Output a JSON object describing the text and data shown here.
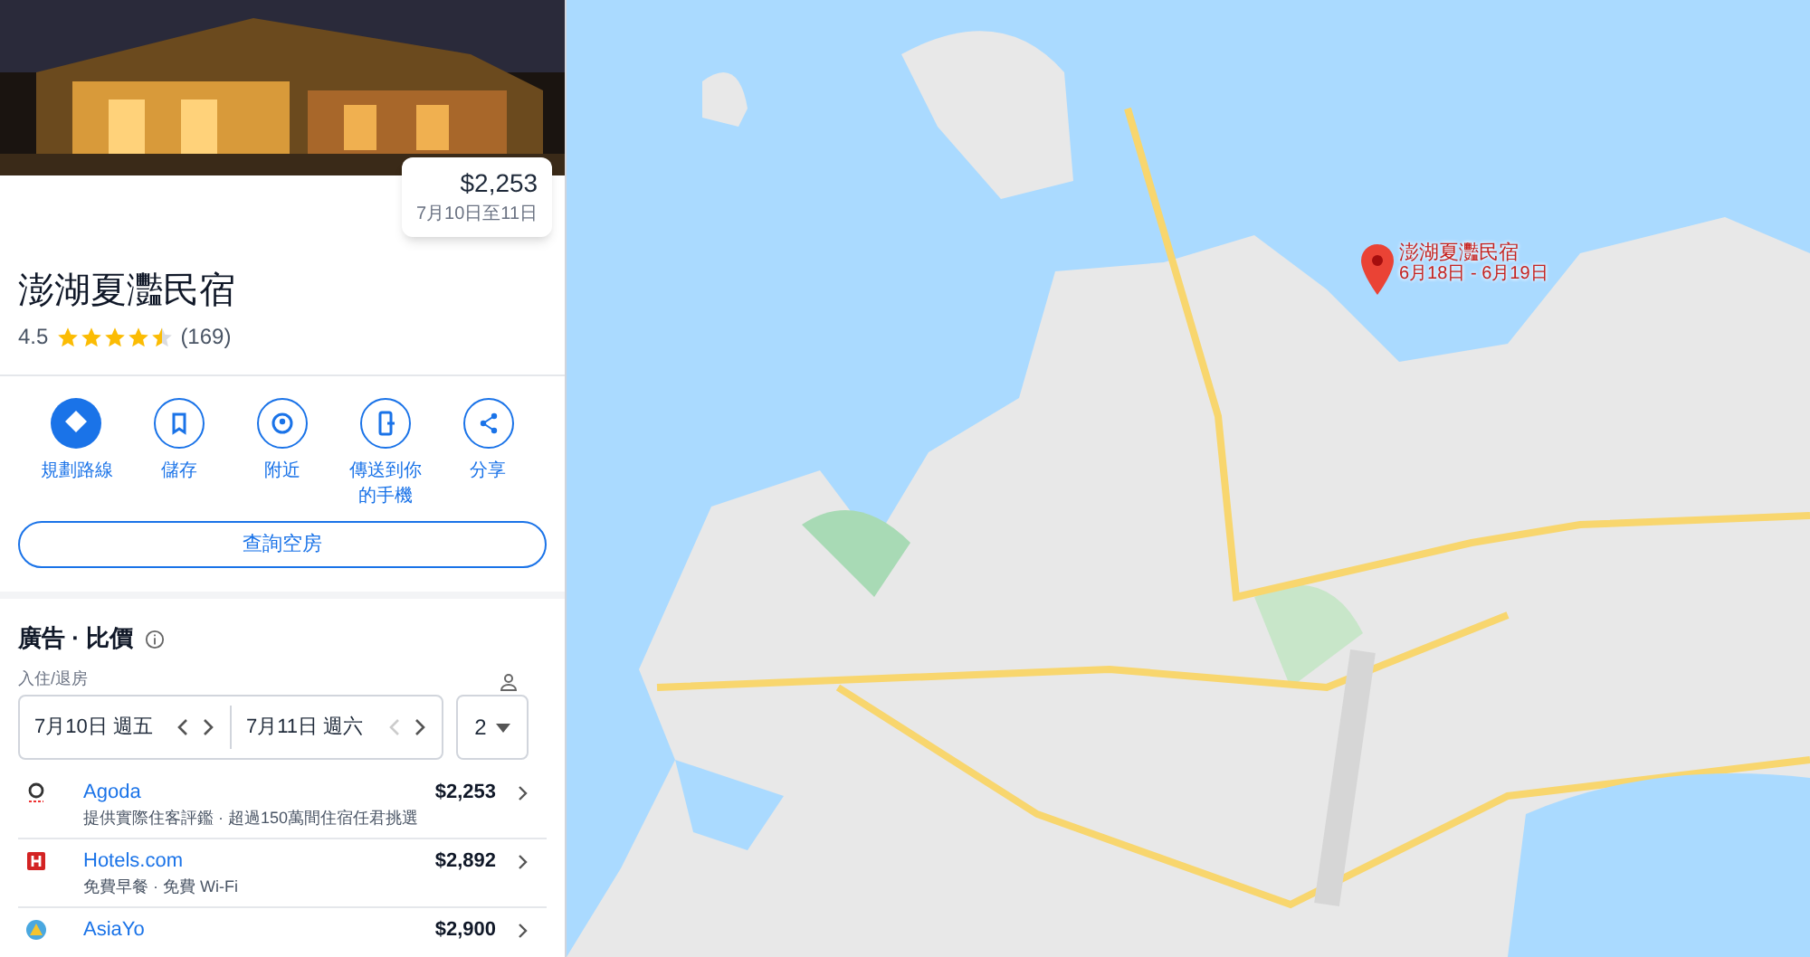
{
  "place": {
    "price_card": {
      "price": "$2,253",
      "dates": "7月10日至11日"
    },
    "name": "澎湖夏灩民宿",
    "rating": {
      "score": "4.5",
      "stars": 4.5,
      "count": "(169)"
    }
  },
  "actions": [
    {
      "kind": "directions",
      "label": "規劃路線",
      "primary": true
    },
    {
      "kind": "save",
      "label": "儲存",
      "primary": false
    },
    {
      "kind": "nearby",
      "label": "附近",
      "primary": false
    },
    {
      "kind": "send",
      "label": "傳送到你的手機",
      "primary": false
    },
    {
      "kind": "share",
      "label": "分享",
      "primary": false
    }
  ],
  "availability_button": "查詢空房",
  "prices": {
    "title": "廣告 · 比價",
    "dates_label": "入住/退房",
    "check_in": "7月10日 週五",
    "check_out": "7月11日 週六",
    "guests": "2",
    "offers": [
      {
        "kind": "agoda",
        "provider": "Agoda",
        "price": "$2,253",
        "note": "提供實際住客評鑑 · 超過150萬間住宿任君挑選"
      },
      {
        "kind": "hotels",
        "provider": "Hotels.com",
        "price": "$2,892",
        "note": "免費早餐 · 免費 Wi-Fi"
      },
      {
        "kind": "asiayo",
        "provider": "AsiaYo",
        "price": "$2,900"
      }
    ]
  },
  "map": {
    "kind": "picture",
    "marker": {
      "name": "澎湖夏灩民宿",
      "dates": "6月18日 - 6月19日"
    }
  }
}
